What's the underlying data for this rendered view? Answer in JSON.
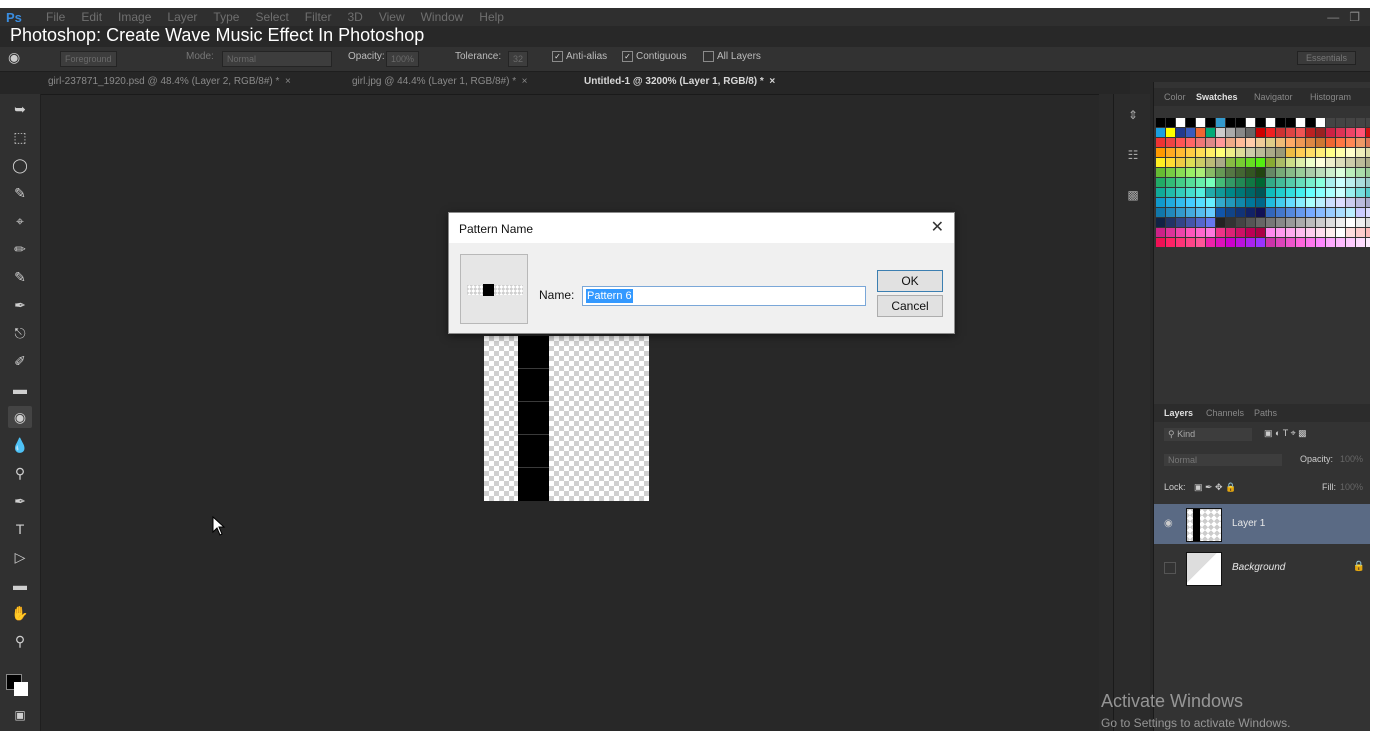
{
  "video_title": "Photoshop: Create Wave Music Effect In Photoshop",
  "menu": [
    "File",
    "Edit",
    "Image",
    "Layer",
    "Type",
    "Select",
    "Filter",
    "3D",
    "View",
    "Window",
    "Help"
  ],
  "app_logo": "Ps",
  "options": {
    "fill_source": "Foreground",
    "mode_label": "Mode:",
    "mode_value": "Normal",
    "opacity_label": "Opacity:",
    "opacity_value": "100%",
    "tolerance_label": "Tolerance:",
    "tolerance_value": "32",
    "anti_alias": "Anti-alias",
    "contiguous": "Contiguous",
    "all_layers": "All Layers",
    "workspace": "Essentials"
  },
  "tabs": [
    {
      "label": "girl-237871_1920.psd @ 48.4% (Layer 2, RGB/8#) *"
    },
    {
      "label": "girl.jpg @ 44.4% (Layer 1, RGB/8#) *"
    },
    {
      "label": "Untitled-1 @ 3200% (Layer 1, RGB/8) *"
    }
  ],
  "dialog": {
    "title": "Pattern Name",
    "name_label": "Name:",
    "name_value": "Pattern 6",
    "ok": "OK",
    "cancel": "Cancel",
    "close": "✕"
  },
  "swatch_panel_tabs": [
    "Color",
    "Swatches",
    "Navigator",
    "Histogram"
  ],
  "layers_panel": {
    "tabs": [
      "Layers",
      "Channels",
      "Paths"
    ],
    "filter": "Kind",
    "blend_mode": "Normal",
    "opacity_label": "Opacity:",
    "opacity_value": "100%",
    "lock_label": "Lock:",
    "fill_label": "Fill:",
    "fill_value": "100%",
    "layers": [
      {
        "name": "Layer 1",
        "selected": true
      },
      {
        "name": "Background",
        "selected": false
      }
    ]
  },
  "watermark": {
    "line1": "Activate Windows",
    "line2": "Go to Settings to activate Windows."
  }
}
